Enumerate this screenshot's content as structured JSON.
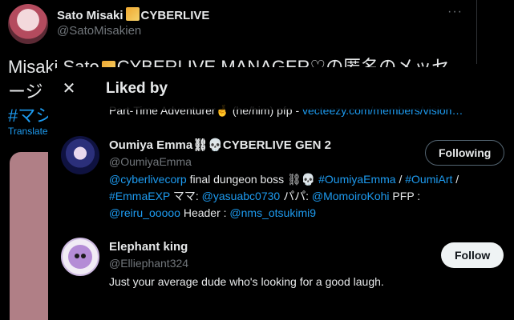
{
  "background_tweet": {
    "author_name": "Sato Misaki",
    "author_suffix": "CYBERLIVE",
    "author_handle": "@SatoMisakien",
    "more_label": "···",
    "text_line1_start": "Misaki Sato",
    "text_line1_end": "CYBERLIVE MANAGER♡の匿名のメッセ",
    "text_line2": "ージ",
    "hashtag": "#マシ",
    "translate_label": "Translate"
  },
  "modal": {
    "title": "Liked by",
    "close_icon": "✕",
    "partial_bio_text": "Part-Time Adventurer",
    "partial_bio_emoji": "🤞",
    "partial_bio_pronouns": " (he/him) pfp - ",
    "partial_bio_link": "vecteezy.com/members/vision…"
  },
  "users": [
    {
      "name": "Oumiya Emma⛓💀CYBERLIVE GEN 2",
      "handle": "@OumiyaEmma",
      "button_label": "Following",
      "bio_line1": [
        {
          "t": "@cyberlivecorp",
          "link": true
        },
        {
          "t": " final dungeon boss ⛓💀 ",
          "link": false
        },
        {
          "t": "#OumiyaEmma",
          "link": true
        },
        {
          "t": " / ",
          "link": false
        },
        {
          "t": "#OumiArt",
          "link": true
        },
        {
          "t": " /",
          "link": false
        }
      ],
      "bio_line2": [
        {
          "t": "#EmmaEXP",
          "link": true
        },
        {
          "t": " ママ: ",
          "link": false
        },
        {
          "t": "@yasuabc0730",
          "link": true
        },
        {
          "t": " パパ: ",
          "link": false
        },
        {
          "t": "@MomoiroKohi",
          "link": true
        },
        {
          "t": " PFP :",
          "link": false
        }
      ],
      "bio_line3": [
        {
          "t": "@reiru_ooooo",
          "link": true
        },
        {
          "t": " Header : ",
          "link": false
        },
        {
          "t": "@nms_otsukimi9",
          "link": true
        }
      ]
    },
    {
      "name": "Elephant king",
      "handle": "@Elliephant324",
      "button_label": "Follow",
      "bio": "Just your average dude who's looking for a good laugh."
    }
  ],
  "colors": {
    "link": "#1d9bf0",
    "muted": "#71767b",
    "text": "#e7e9ea",
    "background": "#000000"
  }
}
